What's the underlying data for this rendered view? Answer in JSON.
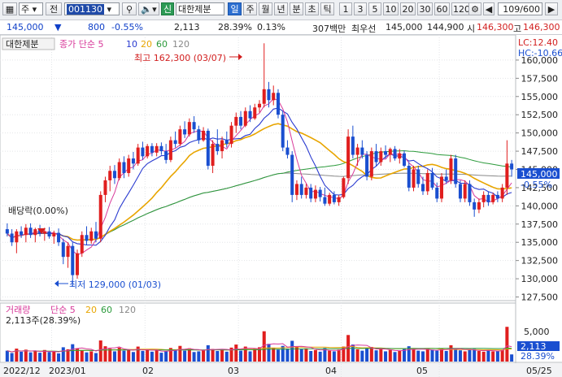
{
  "toolbar": {
    "market": "주",
    "prev_label": "전",
    "code": "001130",
    "search_icon": "search-icon",
    "sound_icon": "speaker-icon",
    "badge": "신",
    "name": "대한제분",
    "periods": [
      "일",
      "주",
      "월",
      "년",
      "분",
      "초",
      "틱"
    ],
    "active_period": "일",
    "intervals": [
      "1",
      "3",
      "5",
      "10",
      "20",
      "30",
      "60",
      "120"
    ],
    "count": "109/600"
  },
  "info": {
    "price": "145,000",
    "change": "800",
    "change_pct": "-0.55%",
    "volume": "2,113",
    "vol_ratio": "28.39%",
    "turnover": "0.13%",
    "amount": "307백만",
    "best_ask_label": "최우선",
    "best_ask": "145,000",
    "best_bid": "144,900",
    "open_label": "시",
    "open": "146,300",
    "high_label": "고",
    "high": "146,300"
  },
  "legend": {
    "name": "대한제분",
    "ma_title": "종가 단순 5",
    "ma_10": "10",
    "ma_20": "20",
    "ma_60": "60",
    "ma_120": "120",
    "lc": "LC:12.40",
    "hc": "HC:-10.66"
  },
  "annotations": {
    "high": "최고 162,300 (03/07)",
    "low": "최저 129,000 (01/03)",
    "dividend": "배당락(0.00%)"
  },
  "price_axis": [
    "160,000",
    "157,500",
    "155,000",
    "152,500",
    "150,000",
    "147,500",
    "145,000",
    "142,500",
    "140,000",
    "137,500",
    "135,000",
    "132,500",
    "130,000",
    "127,500"
  ],
  "price_tag": "145,000",
  "price_tag_pct": "-0.55%",
  "volume_panel": {
    "title": "거래량",
    "ma_title": "단순 5",
    "ma_20": "20",
    "ma_60": "60",
    "ma_120": "120",
    "current": "2,113주(28.39%)",
    "axis_label": "5,000",
    "tag": "2,113",
    "tag_pct": "28.39%"
  },
  "date_axis": [
    "2022/12",
    "2023/01",
    "02",
    "03",
    "04",
    "05",
    "05/25"
  ],
  "colors": {
    "up": "#e01e1e",
    "down": "#1a4fd0",
    "ma5": "#d83a9a",
    "ma10": "#2a3bd0",
    "ma20": "#e8a500",
    "ma60": "#2b9a3b",
    "ma120": "#888888"
  },
  "chart_data": {
    "type": "candlestick",
    "y_range": [
      127000,
      163000
    ],
    "candles": [
      {
        "o": 136800,
        "h": 137600,
        "l": 135800,
        "c": 136200
      },
      {
        "o": 136200,
        "h": 136800,
        "l": 134500,
        "c": 135000
      },
      {
        "o": 135000,
        "h": 136800,
        "l": 133500,
        "c": 136500
      },
      {
        "o": 136500,
        "h": 137200,
        "l": 135600,
        "c": 136000
      },
      {
        "o": 136000,
        "h": 137500,
        "l": 135000,
        "c": 137000
      },
      {
        "o": 137000,
        "h": 137600,
        "l": 135600,
        "c": 136000
      },
      {
        "o": 136000,
        "h": 137000,
        "l": 135000,
        "c": 136800
      },
      {
        "o": 136800,
        "h": 137400,
        "l": 135800,
        "c": 136200
      },
      {
        "o": 136200,
        "h": 137000,
        "l": 135200,
        "c": 136500
      },
      {
        "o": 136500,
        "h": 137100,
        "l": 135500,
        "c": 135800
      },
      {
        "o": 135800,
        "h": 136600,
        "l": 134800,
        "c": 136300
      },
      {
        "o": 136300,
        "h": 136900,
        "l": 134500,
        "c": 135000
      },
      {
        "o": 135000,
        "h": 135500,
        "l": 132000,
        "c": 133000
      },
      {
        "o": 133000,
        "h": 135000,
        "l": 131500,
        "c": 134500
      },
      {
        "o": 134500,
        "h": 135000,
        "l": 129000,
        "c": 130500
      },
      {
        "o": 130500,
        "h": 134000,
        "l": 130000,
        "c": 133500
      },
      {
        "o": 133500,
        "h": 136500,
        "l": 133000,
        "c": 136000
      },
      {
        "o": 136000,
        "h": 137200,
        "l": 134600,
        "c": 135200
      },
      {
        "o": 135200,
        "h": 137000,
        "l": 134800,
        "c": 136500
      },
      {
        "o": 136500,
        "h": 137800,
        "l": 135000,
        "c": 135500
      },
      {
        "o": 135500,
        "h": 142000,
        "l": 135000,
        "c": 141500
      },
      {
        "o": 141500,
        "h": 144000,
        "l": 140500,
        "c": 143500
      },
      {
        "o": 143500,
        "h": 145500,
        "l": 142000,
        "c": 144800
      },
      {
        "o": 144800,
        "h": 145600,
        "l": 143000,
        "c": 143800
      },
      {
        "o": 143800,
        "h": 146500,
        "l": 143500,
        "c": 146000
      },
      {
        "o": 146000,
        "h": 146800,
        "l": 143800,
        "c": 144500
      },
      {
        "o": 144500,
        "h": 147000,
        "l": 144000,
        "c": 146500
      },
      {
        "o": 146500,
        "h": 147400,
        "l": 145000,
        "c": 145800
      },
      {
        "o": 145800,
        "h": 148500,
        "l": 145500,
        "c": 148000
      },
      {
        "o": 148000,
        "h": 148800,
        "l": 146300,
        "c": 146800
      },
      {
        "o": 146800,
        "h": 148500,
        "l": 146500,
        "c": 148200
      },
      {
        "o": 148200,
        "h": 148600,
        "l": 146800,
        "c": 147300
      },
      {
        "o": 147300,
        "h": 148600,
        "l": 146800,
        "c": 148200
      },
      {
        "o": 148200,
        "h": 148700,
        "l": 147000,
        "c": 147500
      },
      {
        "o": 147500,
        "h": 148500,
        "l": 145800,
        "c": 146300
      },
      {
        "o": 146300,
        "h": 149500,
        "l": 146000,
        "c": 149000
      },
      {
        "o": 149000,
        "h": 150200,
        "l": 148000,
        "c": 148500
      },
      {
        "o": 148500,
        "h": 151000,
        "l": 148200,
        "c": 150500
      },
      {
        "o": 150500,
        "h": 151600,
        "l": 149300,
        "c": 149800
      },
      {
        "o": 149800,
        "h": 152000,
        "l": 149500,
        "c": 151500
      },
      {
        "o": 151500,
        "h": 152300,
        "l": 150000,
        "c": 150500
      },
      {
        "o": 150500,
        "h": 151000,
        "l": 148500,
        "c": 149000
      },
      {
        "o": 149000,
        "h": 150800,
        "l": 148800,
        "c": 150300
      },
      {
        "o": 150300,
        "h": 150600,
        "l": 145000,
        "c": 145500
      },
      {
        "o": 145500,
        "h": 149000,
        "l": 144500,
        "c": 148500
      },
      {
        "o": 148500,
        "h": 150500,
        "l": 147000,
        "c": 147500
      },
      {
        "o": 147500,
        "h": 149500,
        "l": 146500,
        "c": 149000
      },
      {
        "o": 149000,
        "h": 150200,
        "l": 148000,
        "c": 148500
      },
      {
        "o": 148500,
        "h": 151500,
        "l": 148000,
        "c": 151000
      },
      {
        "o": 151000,
        "h": 152800,
        "l": 150000,
        "c": 152200
      },
      {
        "o": 152200,
        "h": 153000,
        "l": 150500,
        "c": 151000
      },
      {
        "o": 151000,
        "h": 153500,
        "l": 150800,
        "c": 153000
      },
      {
        "o": 153000,
        "h": 153800,
        "l": 151500,
        "c": 152000
      },
      {
        "o": 152000,
        "h": 154000,
        "l": 151800,
        "c": 153500
      },
      {
        "o": 153500,
        "h": 154500,
        "l": 152800,
        "c": 154000
      },
      {
        "o": 154000,
        "h": 162300,
        "l": 153500,
        "c": 156000
      },
      {
        "o": 156000,
        "h": 157000,
        "l": 153500,
        "c": 154500
      },
      {
        "o": 154500,
        "h": 156500,
        "l": 153800,
        "c": 155500
      },
      {
        "o": 155500,
        "h": 156000,
        "l": 152000,
        "c": 152500
      },
      {
        "o": 152500,
        "h": 153000,
        "l": 147500,
        "c": 148000
      },
      {
        "o": 148000,
        "h": 149000,
        "l": 146500,
        "c": 147000
      },
      {
        "o": 147000,
        "h": 147500,
        "l": 140500,
        "c": 141500
      },
      {
        "o": 141500,
        "h": 143500,
        "l": 140800,
        "c": 143000
      },
      {
        "o": 143000,
        "h": 144000,
        "l": 141000,
        "c": 141500
      },
      {
        "o": 141500,
        "h": 143000,
        "l": 141000,
        "c": 142500
      },
      {
        "o": 142500,
        "h": 143000,
        "l": 140500,
        "c": 141000
      },
      {
        "o": 141000,
        "h": 142800,
        "l": 140500,
        "c": 142200
      },
      {
        "o": 142200,
        "h": 142600,
        "l": 140600,
        "c": 141200
      },
      {
        "o": 141200,
        "h": 142500,
        "l": 140000,
        "c": 140300
      },
      {
        "o": 140300,
        "h": 141800,
        "l": 140000,
        "c": 141500
      },
      {
        "o": 141500,
        "h": 142000,
        "l": 140200,
        "c": 140500
      },
      {
        "o": 140500,
        "h": 141500,
        "l": 140000,
        "c": 141200
      },
      {
        "o": 141200,
        "h": 144000,
        "l": 141000,
        "c": 143800
      },
      {
        "o": 143800,
        "h": 150500,
        "l": 143000,
        "c": 149500
      },
      {
        "o": 149500,
        "h": 151000,
        "l": 146500,
        "c": 147000
      },
      {
        "o": 147000,
        "h": 148500,
        "l": 145500,
        "c": 148000
      },
      {
        "o": 148000,
        "h": 149000,
        "l": 146500,
        "c": 147000
      },
      {
        "o": 147000,
        "h": 147500,
        "l": 143500,
        "c": 144000
      },
      {
        "o": 144000,
        "h": 148000,
        "l": 143500,
        "c": 147500
      },
      {
        "o": 147500,
        "h": 148500,
        "l": 145500,
        "c": 146000
      },
      {
        "o": 146000,
        "h": 148000,
        "l": 145500,
        "c": 147500
      },
      {
        "o": 147500,
        "h": 148300,
        "l": 146500,
        "c": 147000
      },
      {
        "o": 147000,
        "h": 148000,
        "l": 146000,
        "c": 147800
      },
      {
        "o": 147800,
        "h": 148200,
        "l": 146200,
        "c": 146500
      },
      {
        "o": 146500,
        "h": 147800,
        "l": 145800,
        "c": 147200
      },
      {
        "o": 147200,
        "h": 147600,
        "l": 145300,
        "c": 145500
      },
      {
        "o": 145500,
        "h": 146000,
        "l": 142000,
        "c": 142500
      },
      {
        "o": 142500,
        "h": 145500,
        "l": 142000,
        "c": 145000
      },
      {
        "o": 145000,
        "h": 145500,
        "l": 142500,
        "c": 143000
      },
      {
        "o": 143000,
        "h": 144000,
        "l": 141500,
        "c": 142000
      },
      {
        "o": 142000,
        "h": 145000,
        "l": 141500,
        "c": 144500
      },
      {
        "o": 144500,
        "h": 145200,
        "l": 142200,
        "c": 142500
      },
      {
        "o": 142500,
        "h": 143200,
        "l": 140500,
        "c": 141000
      },
      {
        "o": 141000,
        "h": 144500,
        "l": 140500,
        "c": 144000
      },
      {
        "o": 144000,
        "h": 145000,
        "l": 143000,
        "c": 143500
      },
      {
        "o": 143500,
        "h": 147000,
        "l": 143000,
        "c": 146500
      },
      {
        "o": 146500,
        "h": 147000,
        "l": 142500,
        "c": 143000
      },
      {
        "o": 143000,
        "h": 143500,
        "l": 140500,
        "c": 141000
      },
      {
        "o": 141000,
        "h": 143500,
        "l": 140500,
        "c": 143000
      },
      {
        "o": 143000,
        "h": 143500,
        "l": 140000,
        "c": 140500
      },
      {
        "o": 140500,
        "h": 141000,
        "l": 138500,
        "c": 139500
      },
      {
        "o": 139500,
        "h": 141000,
        "l": 139000,
        "c": 140500
      },
      {
        "o": 140500,
        "h": 142000,
        "l": 139800,
        "c": 141500
      },
      {
        "o": 141500,
        "h": 142000,
        "l": 140000,
        "c": 140500
      },
      {
        "o": 140500,
        "h": 141800,
        "l": 140200,
        "c": 141500
      },
      {
        "o": 141500,
        "h": 142000,
        "l": 140500,
        "c": 141000
      },
      {
        "o": 141000,
        "h": 143000,
        "l": 140500,
        "c": 142500
      },
      {
        "o": 142500,
        "h": 149000,
        "l": 141500,
        "c": 145800
      },
      {
        "o": 145800,
        "h": 146300,
        "l": 144000,
        "c": 145000
      }
    ],
    "volumes": [
      3.2,
      2.5,
      3.8,
      2.9,
      3.5,
      2.7,
      3.1,
      2.6,
      3.4,
      2.8,
      3.0,
      2.4,
      4.2,
      3.6,
      5.1,
      3.9,
      3.3,
      2.7,
      3.0,
      2.5,
      6.2,
      4.5,
      3.8,
      3.0,
      4.1,
      3.2,
      3.6,
      2.8,
      4.4,
      3.1,
      3.5,
      2.9,
      3.3,
      2.6,
      3.0,
      4.0,
      3.4,
      4.6,
      3.2,
      3.9,
      2.8,
      3.0,
      3.3,
      4.8,
      3.7,
      3.1,
      3.4,
      2.9,
      4.1,
      5.0,
      3.2,
      4.4,
      3.0,
      3.8,
      4.2,
      8.9,
      5.2,
      4.0,
      3.5,
      4.6,
      3.8,
      6.1,
      4.2,
      3.6,
      3.9,
      3.1,
      3.4,
      2.9,
      4.0,
      3.2,
      3.0,
      3.5,
      4.4,
      7.8,
      5.0,
      3.6,
      3.2,
      4.1,
      4.3,
      3.3,
      3.7,
      3.0,
      3.4,
      2.8,
      3.1,
      3.9,
      4.5,
      3.6,
      3.2,
      3.0,
      3.7,
      3.5,
      3.2,
      3.9,
      3.1,
      4.8,
      3.6,
      3.3,
      3.0,
      3.4,
      3.7,
      3.1,
      2.9,
      3.3,
      3.0,
      3.2,
      3.5,
      10.2,
      2.1
    ]
  }
}
